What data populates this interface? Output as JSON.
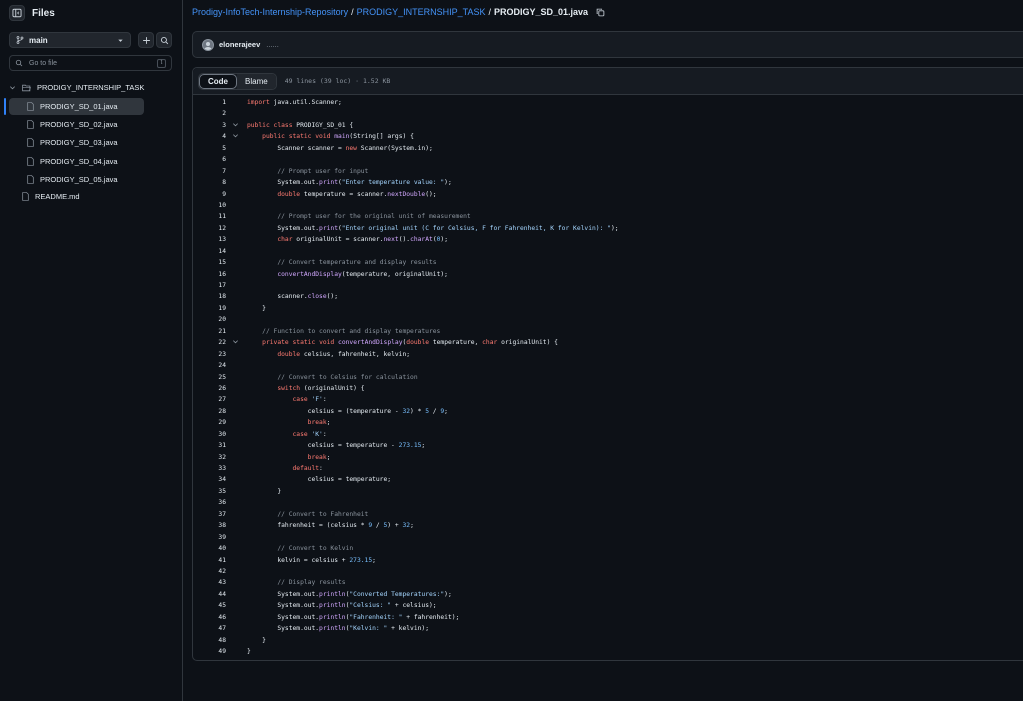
{
  "sidebar": {
    "title": "Files",
    "branch": "main",
    "goto_placeholder": "Go to file",
    "goto_shortcut": "t",
    "folder": "PRODIGY_INTERNSHIP_TASK",
    "files": [
      "PRODIGY_SD_01.java",
      "PRODIGY_SD_02.java",
      "PRODIGY_SD_03.java",
      "PRODIGY_SD_04.java",
      "PRODIGY_SD_05.java"
    ],
    "root_file": "README.md"
  },
  "breadcrumb": {
    "repo": "Prodigy-InfoTech-Internship-Repository",
    "folder": "PRODIGY_INTERNSHIP_TASK",
    "file": "PRODIGY_SD_01.java",
    "sep": "/"
  },
  "commit": {
    "author": "elonerajeev",
    "message": "......"
  },
  "code_view": {
    "tab_code": "Code",
    "tab_blame": "Blame",
    "meta": "49 lines (39 loc) · 1.52 KB"
  },
  "colors": {
    "accent": "#4493f8",
    "keyword": "#ff7b72",
    "function": "#d2a8ff",
    "string": "#a5d6ff",
    "comment": "#8b949e",
    "number": "#79c0ff"
  },
  "code": [
    "import java.util.Scanner;",
    "",
    "public class PRODIGY_SD_01 {",
    "    public static void main(String[] args) {",
    "        Scanner scanner = new Scanner(System.in);",
    "",
    "        // Prompt user for input",
    "        System.out.print(\"Enter temperature value: \");",
    "        double temperature = scanner.nextDouble();",
    "",
    "        // Prompt user for the original unit of measurement",
    "        System.out.print(\"Enter original unit (C for Celsius, F for Fahrenheit, K for Kelvin): \");",
    "        char originalUnit = scanner.next().charAt(0);",
    "",
    "        // Convert temperature and display results",
    "        convertAndDisplay(temperature, originalUnit);",
    "",
    "        scanner.close();",
    "    }",
    "",
    "    // Function to convert and display temperatures",
    "    private static void convertAndDisplay(double temperature, char originalUnit) {",
    "        double celsius, fahrenheit, kelvin;",
    "",
    "        // Convert to Celsius for calculation",
    "        switch (originalUnit) {",
    "            case 'F':",
    "                celsius = (temperature - 32) * 5 / 9;",
    "                break;",
    "            case 'K':",
    "                celsius = temperature - 273.15;",
    "                break;",
    "            default:",
    "                celsius = temperature;",
    "        }",
    "",
    "        // Convert to Fahrenheit",
    "        fahrenheit = (celsius * 9 / 5) + 32;",
    "",
    "        // Convert to Kelvin",
    "        kelvin = celsius + 273.15;",
    "",
    "        // Display results",
    "        System.out.println(\"Converted Temperatures:\");",
    "        System.out.println(\"Celsius: \" + celsius);",
    "        System.out.println(\"Fahrenheit: \" + fahrenheit);",
    "        System.out.println(\"Kelvin: \" + kelvin);",
    "    }",
    "}"
  ],
  "fold_lines": [
    3,
    4,
    22
  ]
}
